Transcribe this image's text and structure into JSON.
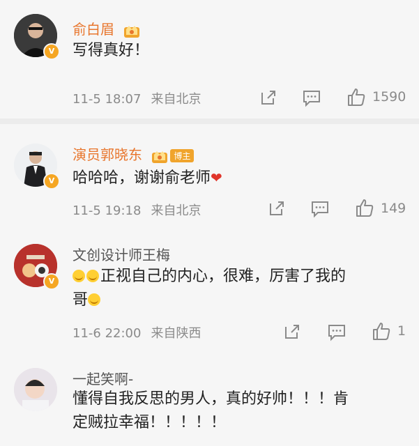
{
  "comments": [
    {
      "author": "俞白眉",
      "text": "写得真好！",
      "date": "11-5 18:07",
      "location": "来自北京",
      "likes": "1590",
      "badge": "V"
    },
    {
      "author": "演员郭晓东",
      "tag": "博主",
      "text": "哈哈哈，谢谢俞老师",
      "date": "11-5 19:18",
      "location": "来自北京",
      "likes": "149",
      "badge": "V"
    },
    {
      "author": "文创设计师王梅",
      "text_line1": "正视自己的内心，很难，厉害了我的",
      "text_line2": "哥",
      "date": "11-6 22:00",
      "location": "来自陕西",
      "likes": "1",
      "badge": "V"
    },
    {
      "author": "一起笑啊-",
      "text_line1": "懂得自我反思的男人，真的好帅！！！肯",
      "text_line2": "定贼拉幸福！！！！！"
    }
  ],
  "icons": {
    "share": "share-icon",
    "comment": "comment-icon",
    "like": "thumbs-up-icon"
  },
  "colors": {
    "vip_name": "#e8762d",
    "badge": "#f5a623",
    "heart": "#e0352b"
  }
}
